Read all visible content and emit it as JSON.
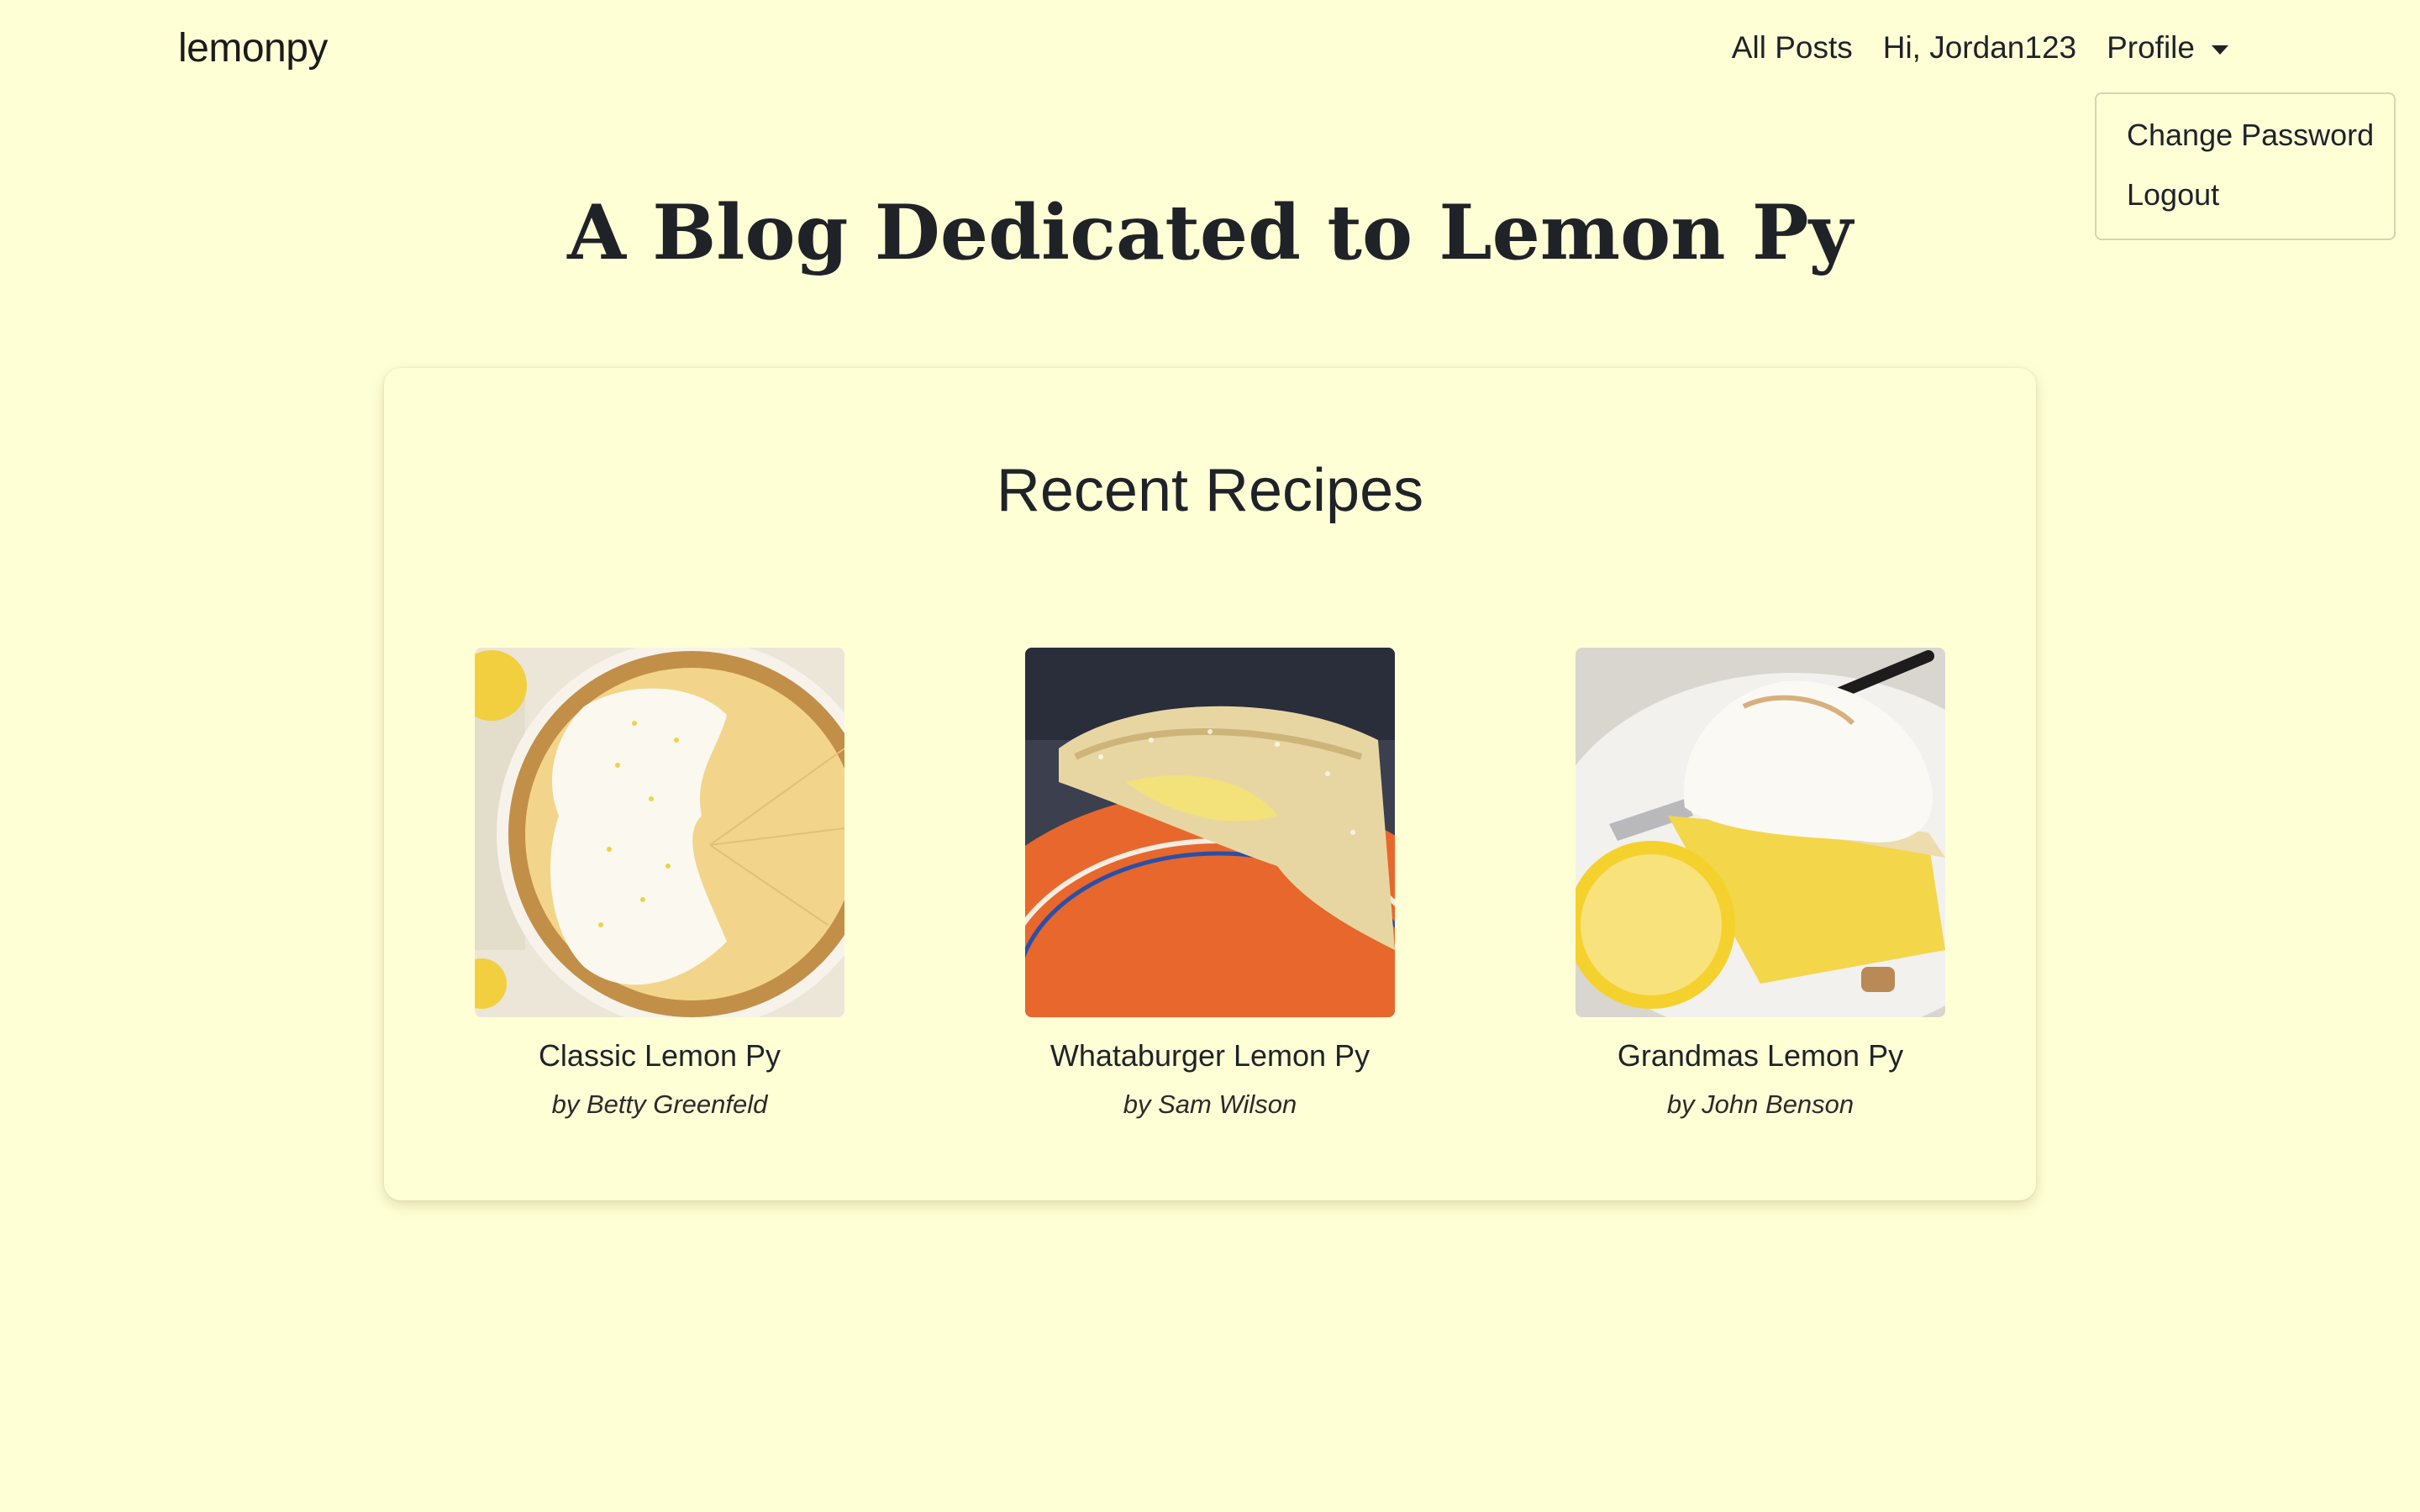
{
  "nav": {
    "brand": "lemonpy",
    "all_posts": "All Posts",
    "greeting": "Hi, Jordan123",
    "profile": "Profile",
    "dropdown": {
      "change_password": "Change Password",
      "logout": "Logout"
    }
  },
  "page_title": "A Blog Dedicated to Lemon Py",
  "recent": {
    "title": "Recent Recipes",
    "recipes": [
      {
        "name": "Classic Lemon Py",
        "author": "by Betty Greenfeld",
        "image": "classic-lemon-pie-photo"
      },
      {
        "name": "Whataburger Lemon Py",
        "author": "by Sam Wilson",
        "image": "fried-lemon-pie-photo"
      },
      {
        "name": "Grandmas Lemon Py",
        "author": "by John Benson",
        "image": "lemon-meringue-pie-photo"
      }
    ]
  },
  "colors": {
    "background": "#ffffd6",
    "text": "#1f2328"
  }
}
